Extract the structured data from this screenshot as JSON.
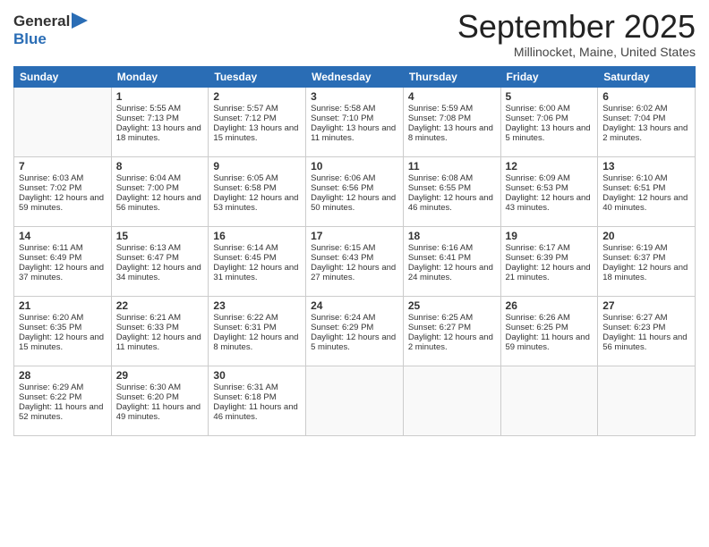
{
  "logo": {
    "general": "General",
    "blue": "Blue"
  },
  "header": {
    "month": "September 2025",
    "location": "Millinocket, Maine, United States"
  },
  "days": [
    "Sunday",
    "Monday",
    "Tuesday",
    "Wednesday",
    "Thursday",
    "Friday",
    "Saturday"
  ],
  "weeks": [
    [
      {
        "day": "",
        "sunrise": "",
        "sunset": "",
        "daylight": ""
      },
      {
        "day": "1",
        "sunrise": "Sunrise: 5:55 AM",
        "sunset": "Sunset: 7:13 PM",
        "daylight": "Daylight: 13 hours and 18 minutes."
      },
      {
        "day": "2",
        "sunrise": "Sunrise: 5:57 AM",
        "sunset": "Sunset: 7:12 PM",
        "daylight": "Daylight: 13 hours and 15 minutes."
      },
      {
        "day": "3",
        "sunrise": "Sunrise: 5:58 AM",
        "sunset": "Sunset: 7:10 PM",
        "daylight": "Daylight: 13 hours and 11 minutes."
      },
      {
        "day": "4",
        "sunrise": "Sunrise: 5:59 AM",
        "sunset": "Sunset: 7:08 PM",
        "daylight": "Daylight: 13 hours and 8 minutes."
      },
      {
        "day": "5",
        "sunrise": "Sunrise: 6:00 AM",
        "sunset": "Sunset: 7:06 PM",
        "daylight": "Daylight: 13 hours and 5 minutes."
      },
      {
        "day": "6",
        "sunrise": "Sunrise: 6:02 AM",
        "sunset": "Sunset: 7:04 PM",
        "daylight": "Daylight: 13 hours and 2 minutes."
      }
    ],
    [
      {
        "day": "7",
        "sunrise": "Sunrise: 6:03 AM",
        "sunset": "Sunset: 7:02 PM",
        "daylight": "Daylight: 12 hours and 59 minutes."
      },
      {
        "day": "8",
        "sunrise": "Sunrise: 6:04 AM",
        "sunset": "Sunset: 7:00 PM",
        "daylight": "Daylight: 12 hours and 56 minutes."
      },
      {
        "day": "9",
        "sunrise": "Sunrise: 6:05 AM",
        "sunset": "Sunset: 6:58 PM",
        "daylight": "Daylight: 12 hours and 53 minutes."
      },
      {
        "day": "10",
        "sunrise": "Sunrise: 6:06 AM",
        "sunset": "Sunset: 6:56 PM",
        "daylight": "Daylight: 12 hours and 50 minutes."
      },
      {
        "day": "11",
        "sunrise": "Sunrise: 6:08 AM",
        "sunset": "Sunset: 6:55 PM",
        "daylight": "Daylight: 12 hours and 46 minutes."
      },
      {
        "day": "12",
        "sunrise": "Sunrise: 6:09 AM",
        "sunset": "Sunset: 6:53 PM",
        "daylight": "Daylight: 12 hours and 43 minutes."
      },
      {
        "day": "13",
        "sunrise": "Sunrise: 6:10 AM",
        "sunset": "Sunset: 6:51 PM",
        "daylight": "Daylight: 12 hours and 40 minutes."
      }
    ],
    [
      {
        "day": "14",
        "sunrise": "Sunrise: 6:11 AM",
        "sunset": "Sunset: 6:49 PM",
        "daylight": "Daylight: 12 hours and 37 minutes."
      },
      {
        "day": "15",
        "sunrise": "Sunrise: 6:13 AM",
        "sunset": "Sunset: 6:47 PM",
        "daylight": "Daylight: 12 hours and 34 minutes."
      },
      {
        "day": "16",
        "sunrise": "Sunrise: 6:14 AM",
        "sunset": "Sunset: 6:45 PM",
        "daylight": "Daylight: 12 hours and 31 minutes."
      },
      {
        "day": "17",
        "sunrise": "Sunrise: 6:15 AM",
        "sunset": "Sunset: 6:43 PM",
        "daylight": "Daylight: 12 hours and 27 minutes."
      },
      {
        "day": "18",
        "sunrise": "Sunrise: 6:16 AM",
        "sunset": "Sunset: 6:41 PM",
        "daylight": "Daylight: 12 hours and 24 minutes."
      },
      {
        "day": "19",
        "sunrise": "Sunrise: 6:17 AM",
        "sunset": "Sunset: 6:39 PM",
        "daylight": "Daylight: 12 hours and 21 minutes."
      },
      {
        "day": "20",
        "sunrise": "Sunrise: 6:19 AM",
        "sunset": "Sunset: 6:37 PM",
        "daylight": "Daylight: 12 hours and 18 minutes."
      }
    ],
    [
      {
        "day": "21",
        "sunrise": "Sunrise: 6:20 AM",
        "sunset": "Sunset: 6:35 PM",
        "daylight": "Daylight: 12 hours and 15 minutes."
      },
      {
        "day": "22",
        "sunrise": "Sunrise: 6:21 AM",
        "sunset": "Sunset: 6:33 PM",
        "daylight": "Daylight: 12 hours and 11 minutes."
      },
      {
        "day": "23",
        "sunrise": "Sunrise: 6:22 AM",
        "sunset": "Sunset: 6:31 PM",
        "daylight": "Daylight: 12 hours and 8 minutes."
      },
      {
        "day": "24",
        "sunrise": "Sunrise: 6:24 AM",
        "sunset": "Sunset: 6:29 PM",
        "daylight": "Daylight: 12 hours and 5 minutes."
      },
      {
        "day": "25",
        "sunrise": "Sunrise: 6:25 AM",
        "sunset": "Sunset: 6:27 PM",
        "daylight": "Daylight: 12 hours and 2 minutes."
      },
      {
        "day": "26",
        "sunrise": "Sunrise: 6:26 AM",
        "sunset": "Sunset: 6:25 PM",
        "daylight": "Daylight: 11 hours and 59 minutes."
      },
      {
        "day": "27",
        "sunrise": "Sunrise: 6:27 AM",
        "sunset": "Sunset: 6:23 PM",
        "daylight": "Daylight: 11 hours and 56 minutes."
      }
    ],
    [
      {
        "day": "28",
        "sunrise": "Sunrise: 6:29 AM",
        "sunset": "Sunset: 6:22 PM",
        "daylight": "Daylight: 11 hours and 52 minutes."
      },
      {
        "day": "29",
        "sunrise": "Sunrise: 6:30 AM",
        "sunset": "Sunset: 6:20 PM",
        "daylight": "Daylight: 11 hours and 49 minutes."
      },
      {
        "day": "30",
        "sunrise": "Sunrise: 6:31 AM",
        "sunset": "Sunset: 6:18 PM",
        "daylight": "Daylight: 11 hours and 46 minutes."
      },
      {
        "day": "",
        "sunrise": "",
        "sunset": "",
        "daylight": ""
      },
      {
        "day": "",
        "sunrise": "",
        "sunset": "",
        "daylight": ""
      },
      {
        "day": "",
        "sunrise": "",
        "sunset": "",
        "daylight": ""
      },
      {
        "day": "",
        "sunrise": "",
        "sunset": "",
        "daylight": ""
      }
    ]
  ]
}
